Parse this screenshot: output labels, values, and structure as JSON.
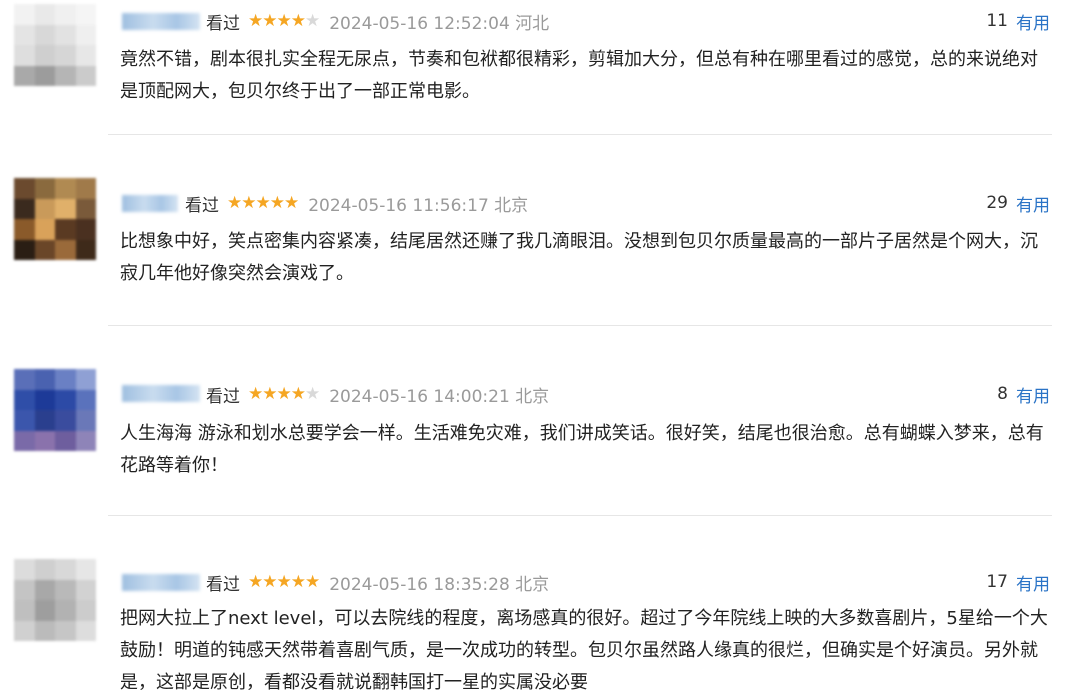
{
  "reviews": [
    {
      "status": "看过",
      "rating": 4,
      "time": "2024-05-16 12:52:04",
      "location": "河北",
      "votes": "11",
      "useful_label": "有用",
      "text": "竟然不错，剧本很扎实全程无尿点，节奏和包袱都很精彩，剪辑加大分，但总有种在哪里看过的感觉，总的来说绝对是顶配网大，包贝尔终于出了一部正常电影。"
    },
    {
      "status": "看过",
      "rating": 5,
      "time": "2024-05-16 11:56:17",
      "location": "北京",
      "votes": "29",
      "useful_label": "有用",
      "text": "比想象中好，笑点密集内容紧凑，结尾居然还赚了我几滴眼泪。没想到包贝尔质量最高的一部片子居然是个网大，沉寂几年他好像突然会演戏了。"
    },
    {
      "status": "看过",
      "rating": 4,
      "time": "2024-05-16 14:00:21",
      "location": "北京",
      "votes": "8",
      "useful_label": "有用",
      "text": "人生海海 游泳和划水总要学会一样。生活难免灾难，我们讲成笑话。很好笑，结尾也很治愈。总有蝴蝶入梦来，总有花路等着你！"
    },
    {
      "status": "看过",
      "rating": 5,
      "time": "2024-05-16 18:35:28",
      "location": "北京",
      "votes": "17",
      "useful_label": "有用",
      "text": "把网大拉上了next level，可以去院线的程度，离场感真的很好。超过了今年院线上映的大多数喜剧片，5星给一个大鼓励！明道的钝感天然带着喜剧气质，是一次成功的转型。包贝尔虽然路人缘真的很烂，但确实是个好演员。另外就是，这部是原创，看都没看就说翻韩国打一星的实属没必要"
    }
  ]
}
